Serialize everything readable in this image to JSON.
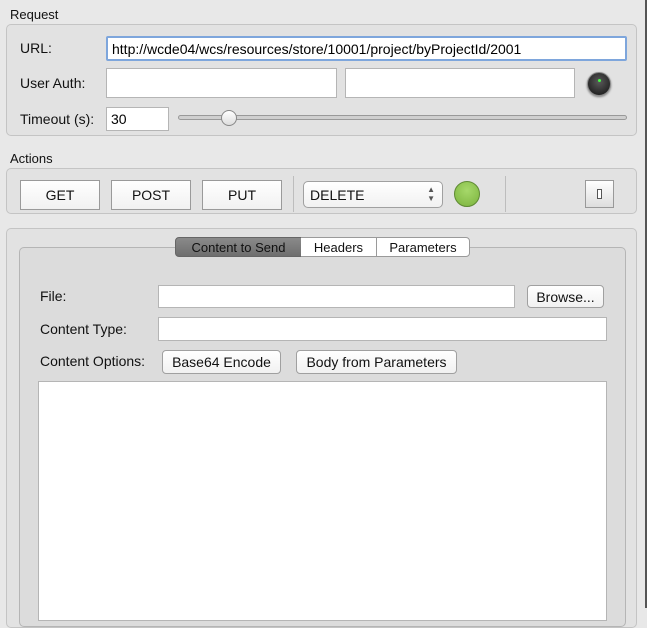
{
  "request": {
    "title": "Request",
    "url_label": "URL:",
    "url_value": "http://wcde04/wcs/resources/store/10001/project/byProjectId/2001",
    "auth_label": "User Auth:",
    "auth_user": "",
    "auth_password": "",
    "timeout_label": "Timeout (s):",
    "timeout_value": "30",
    "timeout_slider_fraction": 0.1
  },
  "actions": {
    "title": "Actions",
    "get": "GET",
    "post": "POST",
    "put": "PUT",
    "method_select": "DELETE",
    "status_color": "#8cc04f"
  },
  "tabs": [
    {
      "label": "Content to Send",
      "active": true
    },
    {
      "label": "Headers"
    },
    {
      "label": "Parameters"
    }
  ],
  "content": {
    "file_label": "File:",
    "file_value": "",
    "browse": "Browse...",
    "type_label": "Content Type:",
    "type_value": "",
    "options_label": "Content Options:",
    "base64": "Base64 Encode",
    "body_from_params": "Body from Parameters",
    "body": ""
  }
}
